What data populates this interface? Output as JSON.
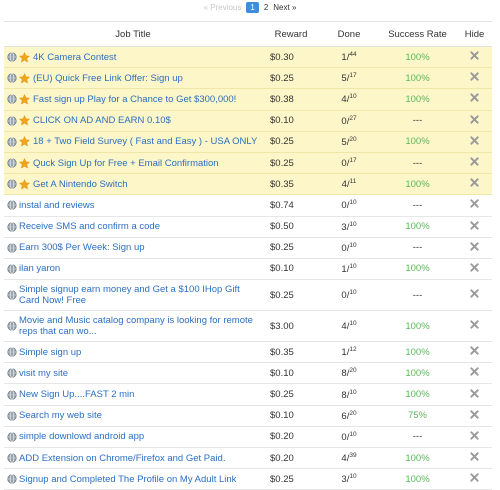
{
  "pagination": {
    "prev_label": "« Previous",
    "pages": [
      "1",
      "2"
    ],
    "current": "1",
    "next_label": "Next »"
  },
  "table": {
    "headers": {
      "title": "Job Title",
      "reward": "Reward",
      "done": "Done",
      "rate": "Success Rate",
      "hide": "Hide"
    },
    "rows": [
      {
        "title": "4K Camera Contest",
        "reward": "$0.30",
        "done": "1",
        "total": "44",
        "rate": "100%",
        "featured": true
      },
      {
        "title": "(EU) Quick Free Link Offer: Sign up",
        "reward": "$0.25",
        "done": "5",
        "total": "17",
        "rate": "100%",
        "featured": true
      },
      {
        "title": "Fast sign up Play for a Chance to Get $300,000!",
        "reward": "$0.38",
        "done": "4",
        "total": "10",
        "rate": "100%",
        "featured": true
      },
      {
        "title": "CLICK ON AD AND EARN 0.10$",
        "reward": "$0.10",
        "done": "0",
        "total": "27",
        "rate": "---",
        "featured": true
      },
      {
        "title": "18 + Two Field Survey ( Fast and Easy ) - USA ONLY",
        "reward": "$0.25",
        "done": "5",
        "total": "20",
        "rate": "100%",
        "featured": true
      },
      {
        "title": "Quck Sign Up for Free + Email Confirmation",
        "reward": "$0.25",
        "done": "0",
        "total": "17",
        "rate": "---",
        "featured": true
      },
      {
        "title": "Get A Nintendo Switch",
        "reward": "$0.35",
        "done": "4",
        "total": "11",
        "rate": "100%",
        "featured": true
      },
      {
        "title": "instal and reviews",
        "reward": "$0.74",
        "done": "0",
        "total": "10",
        "rate": "---",
        "featured": false
      },
      {
        "title": "Receive SMS and confirm a code",
        "reward": "$0.50",
        "done": "3",
        "total": "10",
        "rate": "100%",
        "featured": false
      },
      {
        "title": "Earn 300$ Per Week: Sign up",
        "reward": "$0.25",
        "done": "0",
        "total": "10",
        "rate": "---",
        "featured": false
      },
      {
        "title": "ilan yaron",
        "reward": "$0.10",
        "done": "1",
        "total": "10",
        "rate": "100%",
        "featured": false
      },
      {
        "title": "Simple signup earn money and Get a $100 IHop Gift Card Now! Free",
        "reward": "$0.25",
        "done": "0",
        "total": "10",
        "rate": "---",
        "featured": false,
        "tall": true
      },
      {
        "title": "Movie and Music catalog company is looking for remote reps that can wo...",
        "reward": "$3.00",
        "done": "4",
        "total": "10",
        "rate": "100%",
        "featured": false,
        "tall": true
      },
      {
        "title": "Simple sign up",
        "reward": "$0.35",
        "done": "1",
        "total": "12",
        "rate": "100%",
        "featured": false
      },
      {
        "title": "visit my site",
        "reward": "$0.10",
        "done": "8",
        "total": "20",
        "rate": "100%",
        "featured": false
      },
      {
        "title": "New Sign Up....FAST 2 min",
        "reward": "$0.25",
        "done": "8",
        "total": "10",
        "rate": "100%",
        "featured": false
      },
      {
        "title": "Search my web site",
        "reward": "$0.10",
        "done": "6",
        "total": "20",
        "rate": "75%",
        "featured": false
      },
      {
        "title": "simple downlowd android app",
        "reward": "$0.20",
        "done": "0",
        "total": "10",
        "rate": "---",
        "featured": false
      },
      {
        "title": "ADD Extension on Chrome/Firefox and Get Paid.",
        "reward": "$0.20",
        "done": "4",
        "total": "39",
        "rate": "100%",
        "featured": false
      },
      {
        "title": "Signup and Completed The Profile on My Adult Link",
        "reward": "$0.25",
        "done": "3",
        "total": "10",
        "rate": "100%",
        "featured": false
      }
    ]
  },
  "icons": {
    "globe": "globe-icon",
    "star": "star-icon",
    "hide": "close-icon"
  },
  "colors": {
    "link": "#2b6fc2",
    "featured_bg": "#fdf6c8",
    "success": "#5bb65b",
    "page_active": "#3c8dde",
    "hide_x": "#9a9a9a",
    "star": "#f2a51a"
  }
}
